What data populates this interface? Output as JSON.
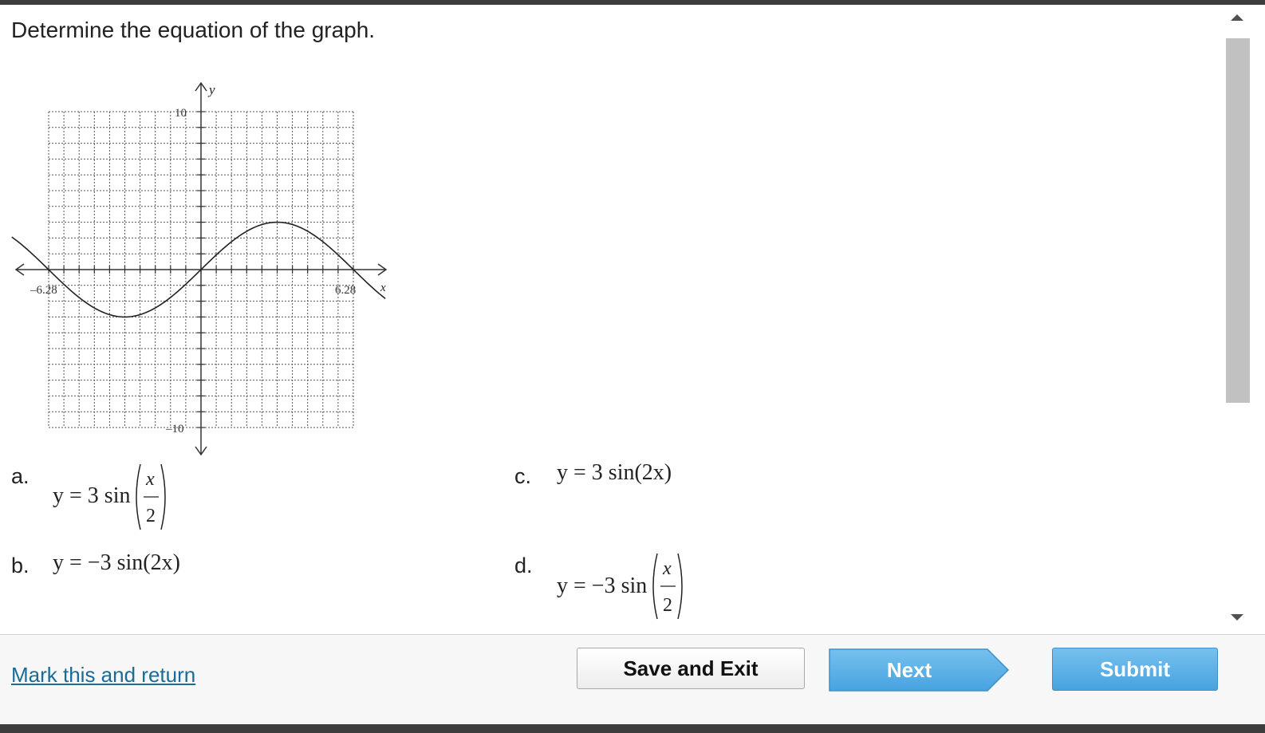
{
  "question": {
    "text": "Determine the equation of the graph."
  },
  "graph": {
    "axis_labels": {
      "x": "x",
      "y": "y"
    },
    "tick_labels": {
      "y_max": "10",
      "y_min": "–10",
      "x_min": "–6.28",
      "x_max": "6.28"
    },
    "chart_data": {
      "type": "line",
      "function": "3 sin(x/2)",
      "xlim": [
        -6.28,
        6.28
      ],
      "ylim": [
        -10,
        10
      ],
      "grid": true,
      "series": [
        {
          "x": [
            -6.28,
            -4.71,
            -3.14,
            -1.57,
            0,
            1.57,
            3.14,
            4.71,
            6.28
          ],
          "y": [
            0,
            -2.12,
            -3,
            -2.12,
            0,
            2.12,
            3,
            2.12,
            0
          ]
        }
      ]
    }
  },
  "choices": {
    "a": {
      "letter": "a.",
      "lhs": "y = 3 sin",
      "num": "x",
      "den": "2"
    },
    "b": {
      "letter": "b.",
      "equation": "y = −3 sin(2x)"
    },
    "c": {
      "letter": "c.",
      "equation": "y = 3 sin(2x)"
    },
    "d": {
      "letter": "d.",
      "lhs": "y = −3 sin",
      "num": "x",
      "den": "2"
    }
  },
  "footer": {
    "mark_link": "Mark this and return",
    "save_exit": "Save and Exit",
    "next": "Next",
    "submit": "Submit"
  },
  "colors": {
    "accent": "#47a3e0",
    "link": "#1a6a9a"
  }
}
